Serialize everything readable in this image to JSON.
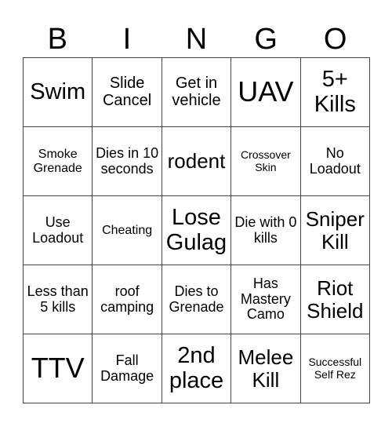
{
  "header": [
    "B",
    "I",
    "N",
    "G",
    "O"
  ],
  "cells": [
    {
      "text": "Swim",
      "size": "s-l"
    },
    {
      "text": "Slide Cancel",
      "size": "s-m"
    },
    {
      "text": "Get in vehicle",
      "size": "s-m"
    },
    {
      "text": "UAV",
      "size": "s-xl"
    },
    {
      "text": "5+ Kills",
      "size": "s-l"
    },
    {
      "text": "Smoke Grenade",
      "size": "s-s"
    },
    {
      "text": "Dies in 10 seconds",
      "size": "s-sm"
    },
    {
      "text": "rodent",
      "size": "s-ml"
    },
    {
      "text": "Crossover Skin",
      "size": "s-xs"
    },
    {
      "text": "No Loadout",
      "size": "s-sm"
    },
    {
      "text": "Use Loadout",
      "size": "s-sm"
    },
    {
      "text": "Cheating",
      "size": "s-s"
    },
    {
      "text": "Lose Gulag",
      "size": "s-l"
    },
    {
      "text": "Die with 0 kills",
      "size": "s-sm"
    },
    {
      "text": "Sniper Kill",
      "size": "s-ml"
    },
    {
      "text": "Less than 5 kills",
      "size": "s-sm"
    },
    {
      "text": "roof camping",
      "size": "s-sm"
    },
    {
      "text": "Dies to Grenade",
      "size": "s-sm"
    },
    {
      "text": "Has Mastery Camo",
      "size": "s-sm"
    },
    {
      "text": "Riot Shield",
      "size": "s-ml"
    },
    {
      "text": "TTV",
      "size": "s-xl"
    },
    {
      "text": "Fall Damage",
      "size": "s-sm"
    },
    {
      "text": "2nd place",
      "size": "s-l"
    },
    {
      "text": "Melee Kill",
      "size": "s-ml"
    },
    {
      "text": "Successful Self Rez",
      "size": "s-xs"
    }
  ]
}
